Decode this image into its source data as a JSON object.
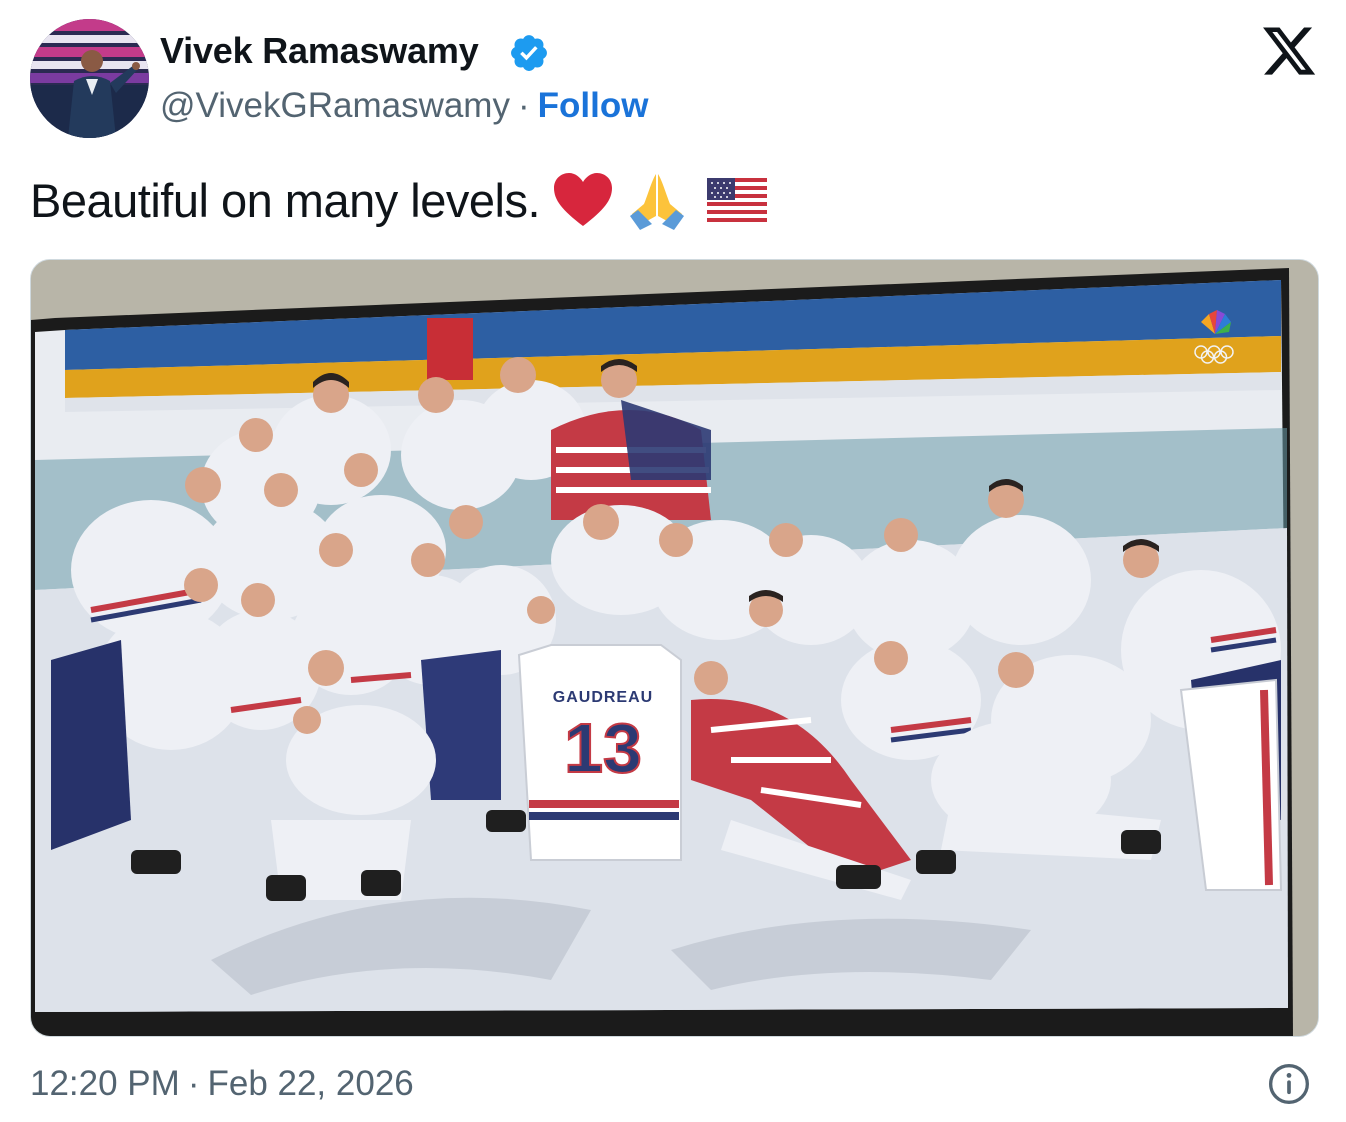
{
  "author": {
    "name": "Vivek Ramaswamy",
    "handle": "@VivekGRamaswamy",
    "separator": "·",
    "follow_label": "Follow",
    "verified": true
  },
  "tweet": {
    "text": "Beautiful on many levels.",
    "emojis": [
      "red-heart",
      "folded-hands",
      "us-flag"
    ]
  },
  "media": {
    "photo_text": {
      "jersey_name": "GAUDREAU",
      "jersey_number": "13"
    }
  },
  "footer": {
    "time": "12:20 PM",
    "separator": "·",
    "date": "Feb 22, 2026"
  },
  "colors": {
    "accent": "#1a73d9",
    "text": "#0f1419",
    "muted": "#536471",
    "verified": "#1d9bf0"
  },
  "icons": {
    "platform": "x-logo-icon",
    "info": "info-icon",
    "verified": "verified-badge-icon"
  }
}
